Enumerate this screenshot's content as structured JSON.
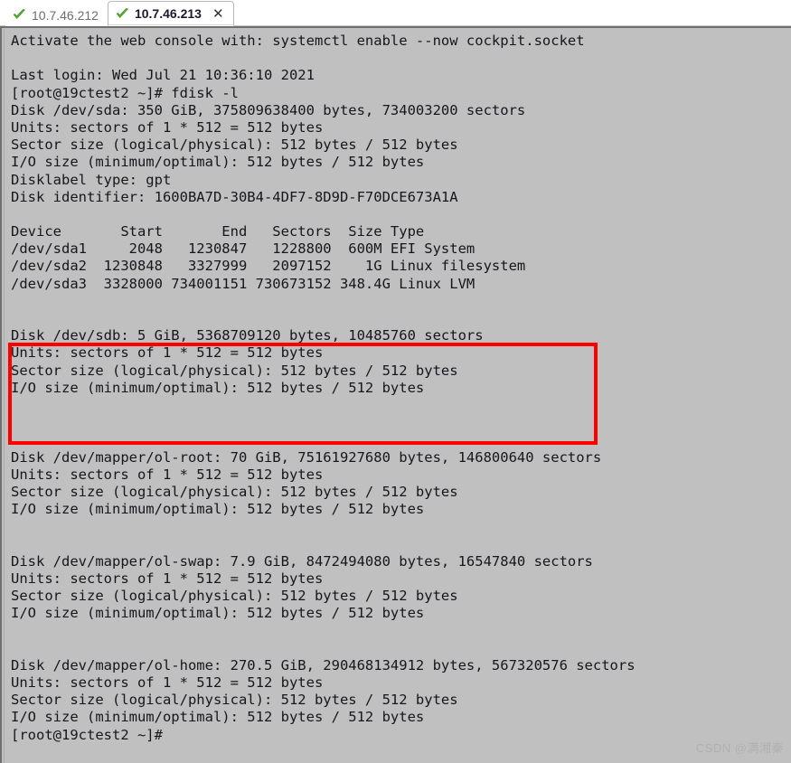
{
  "window": {
    "title": "10.7.46.213",
    "watermark": "CSDN @满湘秦"
  },
  "tabs": [
    {
      "label": "10.7.46.212",
      "active": false,
      "status_icon": "green-check-icon",
      "closable": false
    },
    {
      "label": "10.7.46.213",
      "active": true,
      "status_icon": "green-check-icon",
      "closable": true,
      "close_label": "✕"
    }
  ],
  "colors": {
    "terminal_background": "#c0c0c0",
    "terminal_text": "#16161c",
    "highlight_border": "#fe0000",
    "tab_active_text": "#1a1a2e",
    "tab_inactive_text": "#6d6d6d",
    "check_green": "#4caf27"
  },
  "terminal": {
    "lines": [
      "Activate the web console with: systemctl enable --now cockpit.socket",
      "",
      "Last login: Wed Jul 21 10:36:10 2021",
      "[root@19ctest2 ~]# fdisk -l",
      "Disk /dev/sda: 350 GiB, 375809638400 bytes, 734003200 sectors",
      "Units: sectors of 1 * 512 = 512 bytes",
      "Sector size (logical/physical): 512 bytes / 512 bytes",
      "I/O size (minimum/optimal): 512 bytes / 512 bytes",
      "Disklabel type: gpt",
      "Disk identifier: 1600BA7D-30B4-4DF7-8D9D-F70DCE673A1A",
      "",
      "Device       Start       End   Sectors  Size Type",
      "/dev/sda1     2048   1230847   1228800  600M EFI System",
      "/dev/sda2  1230848   3327999   2097152    1G Linux filesystem",
      "/dev/sda3  3328000 734001151 730673152 348.4G Linux LVM",
      "",
      "",
      "Disk /dev/sdb: 5 GiB, 5368709120 bytes, 10485760 sectors",
      "Units: sectors of 1 * 512 = 512 bytes",
      "Sector size (logical/physical): 512 bytes / 512 bytes",
      "I/O size (minimum/optimal): 512 bytes / 512 bytes",
      "",
      "",
      "",
      "Disk /dev/mapper/ol-root: 70 GiB, 75161927680 bytes, 146800640 sectors",
      "Units: sectors of 1 * 512 = 512 bytes",
      "Sector size (logical/physical): 512 bytes / 512 bytes",
      "I/O size (minimum/optimal): 512 bytes / 512 bytes",
      "",
      "",
      "Disk /dev/mapper/ol-swap: 7.9 GiB, 8472494080 bytes, 16547840 sectors",
      "Units: sectors of 1 * 512 = 512 bytes",
      "Sector size (logical/physical): 512 bytes / 512 bytes",
      "I/O size (minimum/optimal): 512 bytes / 512 bytes",
      "",
      "",
      "Disk /dev/mapper/ol-home: 270.5 GiB, 290468134912 bytes, 567320576 sectors",
      "Units: sectors of 1 * 512 = 512 bytes",
      "Sector size (logical/physical): 512 bytes / 512 bytes",
      "I/O size (minimum/optimal): 512 bytes / 512 bytes",
      "[root@19ctest2 ~]#"
    ],
    "prompt": "[root@19ctest2 ~]#",
    "command": "fdisk -l",
    "highlight": {
      "name": "sdb-disk-highlight",
      "first_line_index": 17,
      "last_line_index": 20,
      "lines": [
        "Disk /dev/sdb: 5 GiB, 5368709120 bytes, 10485760 sectors",
        "Units: sectors of 1 * 512 = 512 bytes",
        "Sector size (logical/physical): 512 bytes / 512 bytes",
        "I/O size (minimum/optimal): 512 bytes / 512 bytes"
      ]
    }
  },
  "disks": [
    {
      "device": "/dev/sda",
      "size": "350 GiB",
      "bytes": "375809638400",
      "sectors": "734003200",
      "units": "sectors of 1 * 512 = 512 bytes",
      "sector_size": "512 bytes / 512 bytes",
      "io_size": "512 bytes / 512 bytes",
      "disklabel_type": "gpt",
      "disk_identifier": "1600BA7D-30B4-4DF7-8D9D-F70DCE673A1A"
    },
    {
      "device": "/dev/sdb",
      "size": "5 GiB",
      "bytes": "5368709120",
      "sectors": "10485760",
      "units": "sectors of 1 * 512 = 512 bytes",
      "sector_size": "512 bytes / 512 bytes",
      "io_size": "512 bytes / 512 bytes"
    },
    {
      "device": "/dev/mapper/ol-root",
      "size": "70 GiB",
      "bytes": "75161927680",
      "sectors": "146800640",
      "units": "sectors of 1 * 512 = 512 bytes",
      "sector_size": "512 bytes / 512 bytes",
      "io_size": "512 bytes / 512 bytes"
    },
    {
      "device": "/dev/mapper/ol-swap",
      "size": "7.9 GiB",
      "bytes": "8472494080",
      "sectors": "16547840",
      "units": "sectors of 1 * 512 = 512 bytes",
      "sector_size": "512 bytes / 512 bytes",
      "io_size": "512 bytes / 512 bytes"
    },
    {
      "device": "/dev/mapper/ol-home",
      "size": "270.5 GiB",
      "bytes": "290468134912",
      "sectors": "567320576",
      "units": "sectors of 1 * 512 = 512 bytes",
      "sector_size": "512 bytes / 512 bytes",
      "io_size": "512 bytes / 512 bytes"
    }
  ],
  "partition_table": {
    "headers": [
      "Device",
      "Start",
      "End",
      "Sectors",
      "Size",
      "Type"
    ],
    "rows": [
      [
        "/dev/sda1",
        "2048",
        "1230847",
        "1228800",
        "600M",
        "EFI System"
      ],
      [
        "/dev/sda2",
        "1230848",
        "3327999",
        "2097152",
        "1G",
        "Linux filesystem"
      ],
      [
        "/dev/sda3",
        "3328000",
        "734001151",
        "730673152",
        "348.4G",
        "Linux LVM"
      ]
    ]
  }
}
